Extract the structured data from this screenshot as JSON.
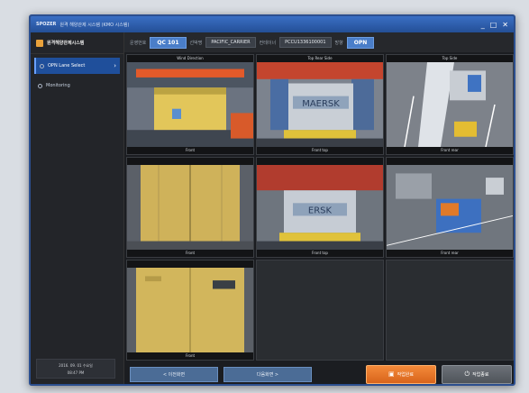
{
  "window": {
    "logo": "SPOZER",
    "title": "원격 해양관제 시스템 (KMO 시스템)",
    "controls": [
      "_",
      "□",
      "✕"
    ]
  },
  "sidebar": {
    "header": "원격해양관제시스템",
    "items": [
      {
        "label": "OPN Lane Select",
        "active": true
      },
      {
        "label": "Monitoring",
        "active": false
      }
    ],
    "footer": [
      "2016. 09. 01 수요일",
      "08:47 PM"
    ]
  },
  "topbar": {
    "label1": "운영번호",
    "crane": "QC 101",
    "label2": "선박명",
    "vessel": "PACIFIC_CARRIER",
    "label3": "컨테이너",
    "container": "PCCU1336100001",
    "label4": "방향",
    "direction": "OPN"
  },
  "cameras": [
    {
      "top": "Wind Direction",
      "bottom": "Front"
    },
    {
      "top": "Top Rear Side",
      "bottom": "Front top"
    },
    {
      "top": "Top Side",
      "bottom": "Front rear"
    },
    {
      "top": "",
      "bottom": "Front"
    },
    {
      "top": "",
      "bottom": "Front top"
    },
    {
      "top": "",
      "bottom": "Front rear"
    },
    {
      "top": "",
      "bottom": "Front"
    }
  ],
  "bottombar": {
    "prev_label": "< 이전화면",
    "next_label": "다음화면 >",
    "save_label": "작업완료",
    "exit_label": "작업종료"
  }
}
